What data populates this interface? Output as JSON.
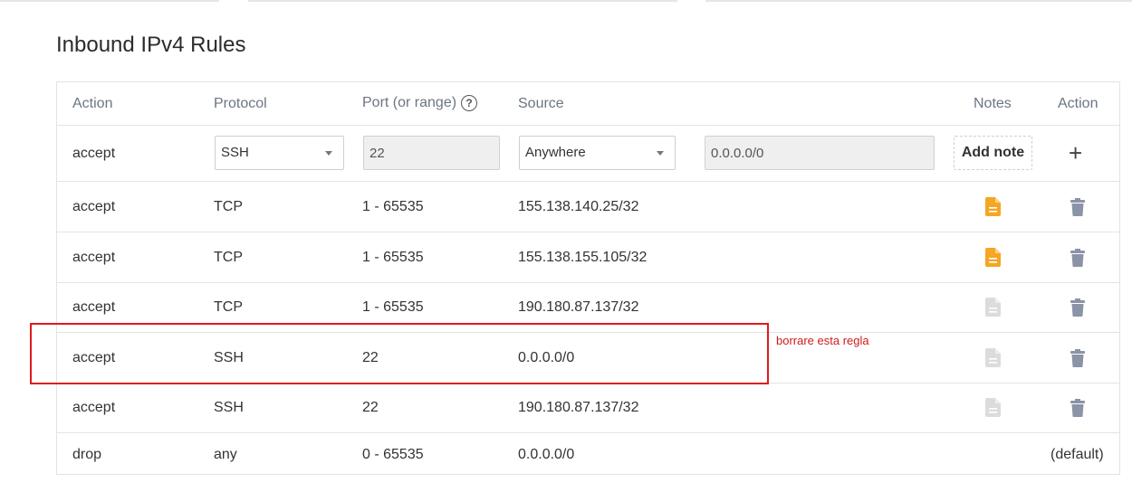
{
  "page_title": "Inbound IPv4 Rules",
  "headers": {
    "action": "Action",
    "protocol": "Protocol",
    "port": "Port (or range)",
    "port_help": "?",
    "source": "Source",
    "notes": "Notes",
    "action_col": "Action"
  },
  "new_rule": {
    "action": "accept",
    "protocol_value": "SSH",
    "port_value": "22",
    "source_value": "Anywhere",
    "address_value": "0.0.0.0/0",
    "add_note_label": "Add note",
    "add_symbol": "+"
  },
  "rules": [
    {
      "action": "accept",
      "protocol": "TCP",
      "port": "1 - 65535",
      "source": "155.138.140.25/32",
      "has_note": true
    },
    {
      "action": "accept",
      "protocol": "TCP",
      "port": "1 - 65535",
      "source": "155.138.155.105/32",
      "has_note": true
    },
    {
      "action": "accept",
      "protocol": "TCP",
      "port": "1 - 65535",
      "source": "190.180.87.137/32",
      "has_note": false
    },
    {
      "action": "accept",
      "protocol": "SSH",
      "port": "22",
      "source": "0.0.0.0/0",
      "has_note": false
    },
    {
      "action": "accept",
      "protocol": "SSH",
      "port": "22",
      "source": "190.180.87.137/32",
      "has_note": false
    }
  ],
  "default_rule": {
    "action": "drop",
    "protocol": "any",
    "port": "0 - 65535",
    "source": "0.0.0.0/0",
    "label": "(default)"
  },
  "annotation": "borrare esta regla",
  "colors": {
    "note_active": "#f5a623",
    "note_inactive": "#dcdcdc",
    "trash": "#8b93a7",
    "highlight": "#e0191d"
  }
}
